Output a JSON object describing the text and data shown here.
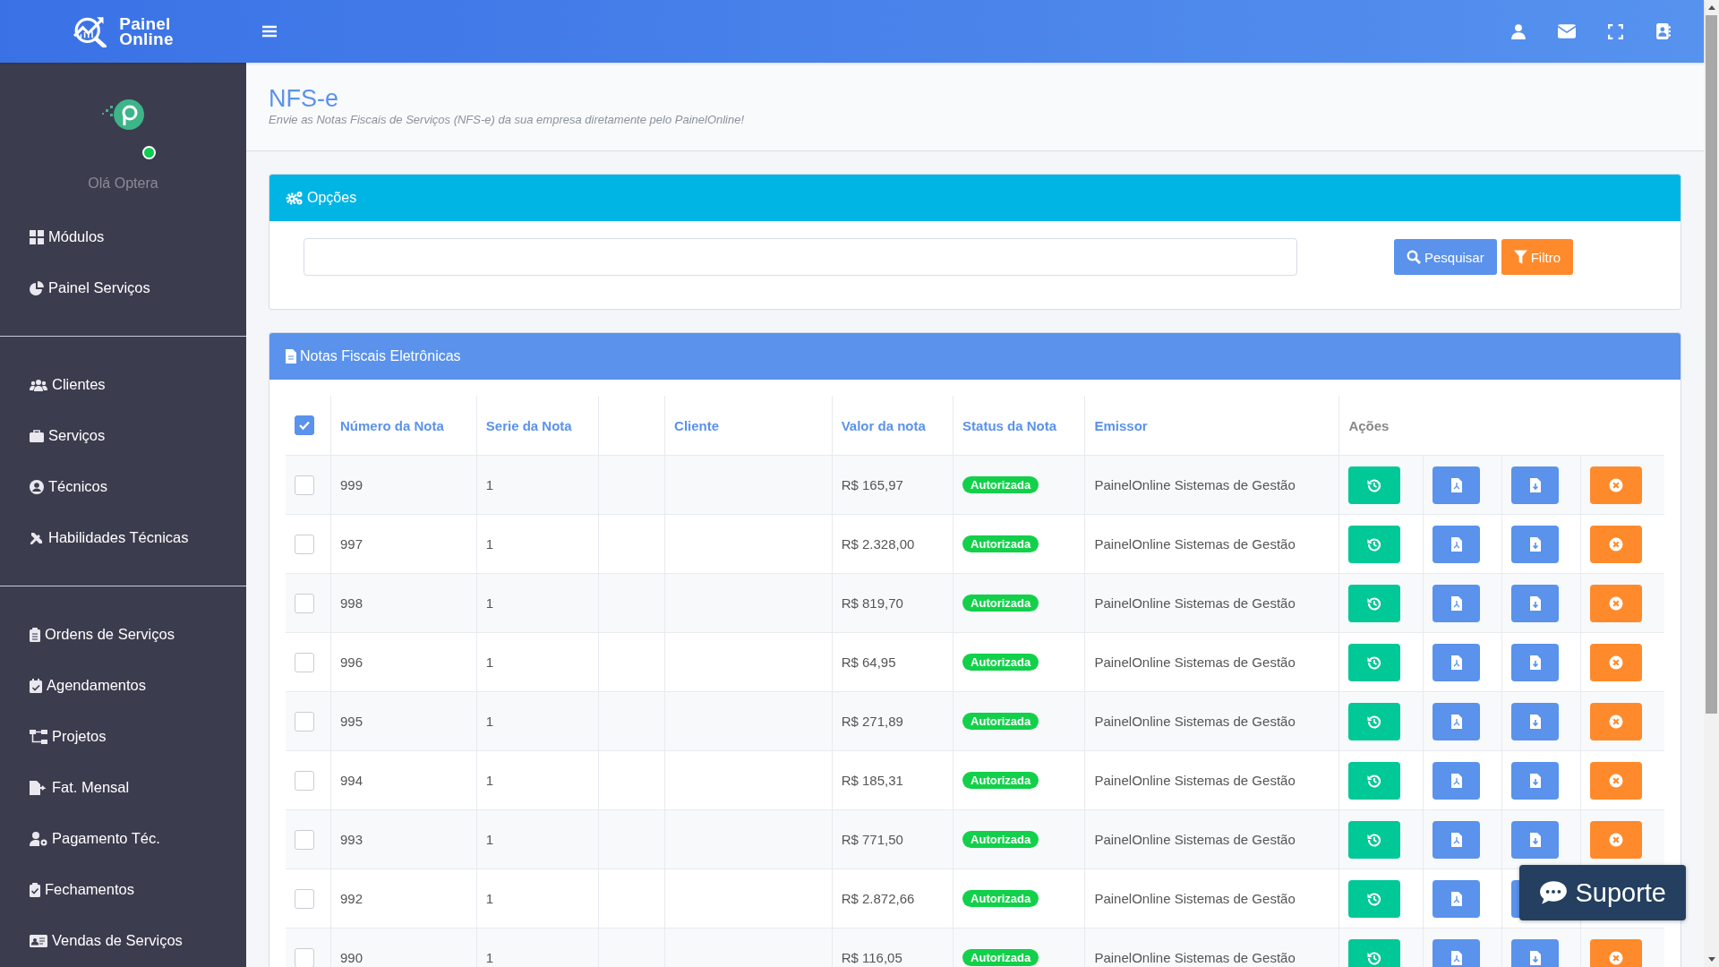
{
  "brand": {
    "line_1": "Painel",
    "line_2": "Online"
  },
  "header_icons": [
    {
      "kind": "user"
    },
    {
      "kind": "mail"
    },
    {
      "kind": "expand"
    },
    {
      "kind": "contacts"
    }
  ],
  "sidebar": {
    "user": {
      "greeting": "Olá Optera",
      "online": true
    },
    "groups": [
      [
        {
          "label": "Módulos",
          "kind": "grid"
        },
        {
          "label": "Painel Serviços",
          "kind": "pie"
        }
      ],
      [
        {
          "label": "Clientes",
          "kind": "users"
        },
        {
          "label": "Serviços",
          "kind": "briefcase"
        },
        {
          "label": "Técnicos",
          "kind": "person"
        },
        {
          "label": "Habilidades Técnicas",
          "kind": "tools"
        }
      ],
      [
        {
          "label": "Ordens de Serviços",
          "kind": "clipboard"
        },
        {
          "label": "Agendamentos",
          "kind": "calendar"
        },
        {
          "label": "Projetos",
          "kind": "sitemap"
        },
        {
          "label": "Fat. Mensal",
          "kind": "file"
        },
        {
          "label": "Pagamento Téc.",
          "kind": "usercog"
        },
        {
          "label": "Fechamentos",
          "kind": "check"
        },
        {
          "label": "Vendas de Serviços",
          "kind": "card"
        }
      ]
    ]
  },
  "page": {
    "title": "NFS-e",
    "subtitle": "Envie as Notas Fiscais de Serviços (NFS-e) da sua empresa diretamente pelo PainelOnline!"
  },
  "options": {
    "title": "Opções",
    "buttons": [
      {
        "label": "Pesquisar",
        "kind": "search"
      },
      {
        "label": "Filtro",
        "kind": "filter"
      }
    ]
  },
  "table": {
    "title": "Notas Fiscais Eletrônicas",
    "select_all": {
      "checked": true
    },
    "columns": [
      "Número da Nota",
      "Serie da Nota",
      "",
      "Cliente",
      "Valor da nota",
      "Status da Nota",
      "Emissor",
      "Ações"
    ],
    "actions": [
      {
        "kind": "history"
      },
      {
        "kind": "pdf"
      },
      {
        "kind": "download"
      },
      {
        "kind": "cancel"
      }
    ],
    "rows": [
      {
        "checked": false,
        "numero": "999",
        "serie": "1",
        "valor": "R$ 165,97",
        "status": "Autorizada",
        "emissor": "PainelOnline Sistemas de Gestão"
      },
      {
        "checked": false,
        "numero": "997",
        "serie": "1",
        "valor": "R$ 2.328,00",
        "status": "Autorizada",
        "emissor": "PainelOnline Sistemas de Gestão"
      },
      {
        "checked": false,
        "numero": "998",
        "serie": "1",
        "valor": "R$ 819,70",
        "status": "Autorizada",
        "emissor": "PainelOnline Sistemas de Gestão"
      },
      {
        "checked": false,
        "numero": "996",
        "serie": "1",
        "valor": "R$ 64,95",
        "status": "Autorizada",
        "emissor": "PainelOnline Sistemas de Gestão"
      },
      {
        "checked": false,
        "numero": "995",
        "serie": "1",
        "valor": "R$ 271,89",
        "status": "Autorizada",
        "emissor": "PainelOnline Sistemas de Gestão"
      },
      {
        "checked": false,
        "numero": "994",
        "serie": "1",
        "valor": "R$ 185,31",
        "status": "Autorizada",
        "emissor": "PainelOnline Sistemas de Gestão"
      },
      {
        "checked": false,
        "numero": "993",
        "serie": "1",
        "valor": "R$ 771,50",
        "status": "Autorizada",
        "emissor": "PainelOnline Sistemas de Gestão"
      },
      {
        "checked": false,
        "numero": "992",
        "serie": "1",
        "valor": "R$ 2.872,66",
        "status": "Autorizada",
        "emissor": "PainelOnline Sistemas de Gestão"
      },
      {
        "checked": false,
        "numero": "990",
        "serie": "1",
        "valor": "R$ 116,05",
        "status": "Autorizada",
        "emissor": "PainelOnline Sistemas de Gestão"
      }
    ]
  },
  "support": {
    "label": "Suporte"
  }
}
